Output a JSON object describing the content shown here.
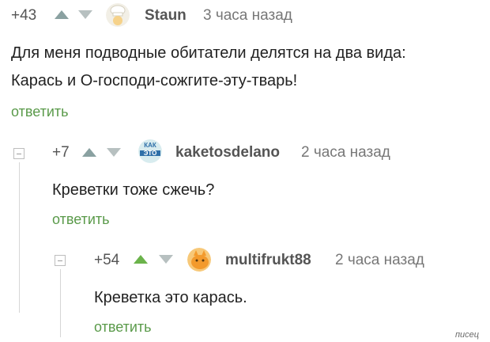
{
  "comments": [
    {
      "rating": "+43",
      "username": "Staun",
      "time": "3 часа назад",
      "lines": [
        "Для меня подводные обитатели делятся на два вида:",
        "Карась и О-господи-сожгите-эту-тварь!"
      ],
      "reply_label": "ответить"
    },
    {
      "rating": "+7",
      "username": "kaketosdelano",
      "time": "2 часа назад",
      "avatar_text": [
        "КАК",
        "ЭТО"
      ],
      "lines": [
        "Креветки тоже сжечь?"
      ],
      "reply_label": "ответить"
    },
    {
      "rating": "+54",
      "username": "multifrukt88",
      "time": "2 часа назад",
      "lines": [
        "Креветка это карась."
      ],
      "reply_label": "ответить"
    }
  ],
  "watermark": "писец",
  "colors": {
    "reply_green": "#5a9a4a",
    "upvote_green": "#6bb34b",
    "arrow_grey": "#8aa1a1"
  },
  "icons": {
    "upvote": "triangle-up-icon",
    "downvote": "triangle-down-icon",
    "collapse": "minus-square-icon"
  }
}
